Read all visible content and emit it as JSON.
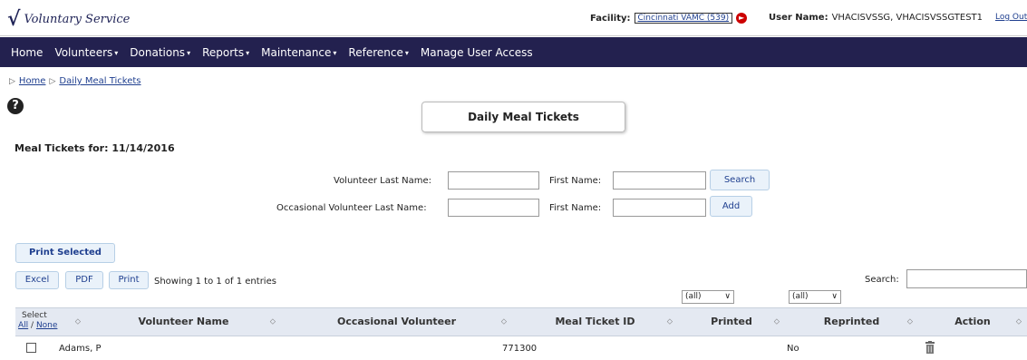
{
  "header": {
    "app_name": "Voluntary Service",
    "facility_label": "Facility:",
    "facility_value": "Cincinnati VAMC (539)",
    "user_label": "User Name:",
    "user_value": "VHACISVSSG, VHACISVSSGTEST1",
    "logout_label": "Log Out"
  },
  "nav": [
    {
      "label": "Home",
      "dropdown": false
    },
    {
      "label": "Volunteers",
      "dropdown": true
    },
    {
      "label": "Donations",
      "dropdown": true
    },
    {
      "label": "Reports",
      "dropdown": true
    },
    {
      "label": "Maintenance",
      "dropdown": true
    },
    {
      "label": "Reference",
      "dropdown": true
    },
    {
      "label": "Manage User Access",
      "dropdown": false
    }
  ],
  "breadcrumb": [
    "Home",
    "Daily Meal Tickets"
  ],
  "page_title": "Daily Meal Tickets",
  "meal_date_label": "Meal Tickets for: 11/14/2016",
  "form": {
    "volunteer_last_name_label": "Volunteer Last Name:",
    "volunteer_first_name_label": "First Name:",
    "occasional_last_name_label": "Occasional Volunteer Last Name:",
    "occasional_first_name_label": "First Name:",
    "volunteer_last_name_value": "",
    "volunteer_first_name_value": "",
    "occasional_last_name_value": "",
    "occasional_first_name_value": "",
    "search_button": "Search",
    "add_button": "Add"
  },
  "print_selected_button": "Print Selected",
  "toolbar": {
    "excel": "Excel",
    "pdf": "PDF",
    "print": "Print"
  },
  "showing_text": "Showing 1 to 1 of 1 entries",
  "search_label": "Search:",
  "search_value": "",
  "filters": {
    "printed": "(all)",
    "reprinted": "(all)"
  },
  "table": {
    "select_header": "Select",
    "select_all": "All",
    "select_none": "None",
    "columns": [
      "Volunteer Name",
      "Occasional Volunteer",
      "Meal Ticket ID",
      "Printed",
      "Reprinted",
      "Action"
    ],
    "rows": [
      {
        "volunteer_name": "Adams, P",
        "occasional_volunteer": "",
        "meal_ticket_id": "771300",
        "printed": "",
        "reprinted": "No"
      }
    ]
  }
}
